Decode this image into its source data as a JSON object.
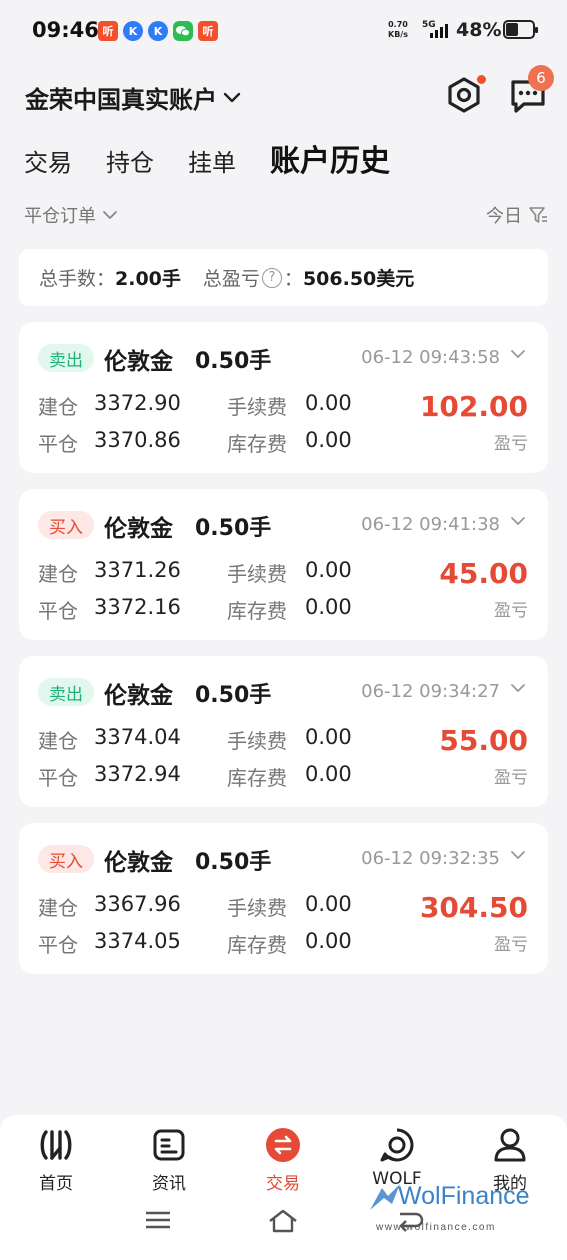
{
  "status_bar": {
    "time": "09:46",
    "net_speed": "0.70",
    "net_unit": "KB/s",
    "signal": "5G",
    "battery": "48%",
    "battery_level": 0.48,
    "notifications": [
      {
        "icon": "listen-app-icon",
        "glyph": "听",
        "color": "#f0502d"
      },
      {
        "icon": "k-app-icon",
        "glyph": "K",
        "color": "#2e7cf6"
      },
      {
        "icon": "k-app-icon",
        "glyph": "K",
        "color": "#2e7cf6"
      },
      {
        "icon": "wechat-icon",
        "glyph": "",
        "color": "#2dbb52"
      },
      {
        "icon": "listen-app-icon",
        "glyph": "听",
        "color": "#f0502d"
      }
    ]
  },
  "header": {
    "account_name": "金荣中国真实账户",
    "message_count": "6"
  },
  "tabs": [
    {
      "label": "交易",
      "active": false
    },
    {
      "label": "持仓",
      "active": false
    },
    {
      "label": "挂单",
      "active": false
    },
    {
      "label": "账户历史",
      "active": true
    }
  ],
  "filter": {
    "order_type": "平仓订单",
    "period": "今日"
  },
  "summary": {
    "lots_label": "总手数：",
    "lots_value": "2.00手",
    "pnl_label": "总盈亏",
    "pnl_colon": "：",
    "pnl_value": "506.50美元"
  },
  "orders": [
    {
      "side": "卖出",
      "side_type": "sell",
      "symbol": "伦敦金",
      "lots": "0.50手",
      "time": "06-12 09:43:58",
      "open_label": "建仓",
      "open_price": "3372.90",
      "close_label": "平仓",
      "close_price": "3370.86",
      "fee_label": "手续费",
      "fee": "0.00",
      "swap_label": "库存费",
      "swap": "0.00",
      "pnl": "102.00",
      "pnl_label": "盈亏"
    },
    {
      "side": "买入",
      "side_type": "buy",
      "symbol": "伦敦金",
      "lots": "0.50手",
      "time": "06-12 09:41:38",
      "open_label": "建仓",
      "open_price": "3371.26",
      "close_label": "平仓",
      "close_price": "3372.16",
      "fee_label": "手续费",
      "fee": "0.00",
      "swap_label": "库存费",
      "swap": "0.00",
      "pnl": "45.00",
      "pnl_label": "盈亏"
    },
    {
      "side": "卖出",
      "side_type": "sell",
      "symbol": "伦敦金",
      "lots": "0.50手",
      "time": "06-12 09:34:27",
      "open_label": "建仓",
      "open_price": "3374.04",
      "close_label": "平仓",
      "close_price": "3372.94",
      "fee_label": "手续费",
      "fee": "0.00",
      "swap_label": "库存费",
      "swap": "0.00",
      "pnl": "55.00",
      "pnl_label": "盈亏"
    },
    {
      "side": "买入",
      "side_type": "buy",
      "symbol": "伦敦金",
      "lots": "0.50手",
      "time": "06-12 09:32:35",
      "open_label": "建仓",
      "open_price": "3367.96",
      "close_label": "平仓",
      "close_price": "3374.05",
      "fee_label": "手续费",
      "fee": "0.00",
      "swap_label": "库存费",
      "swap": "0.00",
      "pnl": "304.50",
      "pnl_label": "盈亏"
    }
  ],
  "bottom_nav": [
    {
      "label": "首页",
      "icon": "home-logo-icon",
      "active": false
    },
    {
      "label": "资讯",
      "icon": "news-icon",
      "active": false
    },
    {
      "label": "交易",
      "icon": "trade-icon",
      "active": true
    },
    {
      "label": "WOLF",
      "icon": "wolf-icon",
      "active": false
    },
    {
      "label": "我的",
      "icon": "profile-icon",
      "active": false
    }
  ],
  "watermark": {
    "brand": "WolFinance",
    "url": "www.wolfinance.com"
  },
  "colors": {
    "accent_red": "#e44a35",
    "sell_green": "#1fb07c",
    "background": "#f4f4f6"
  }
}
